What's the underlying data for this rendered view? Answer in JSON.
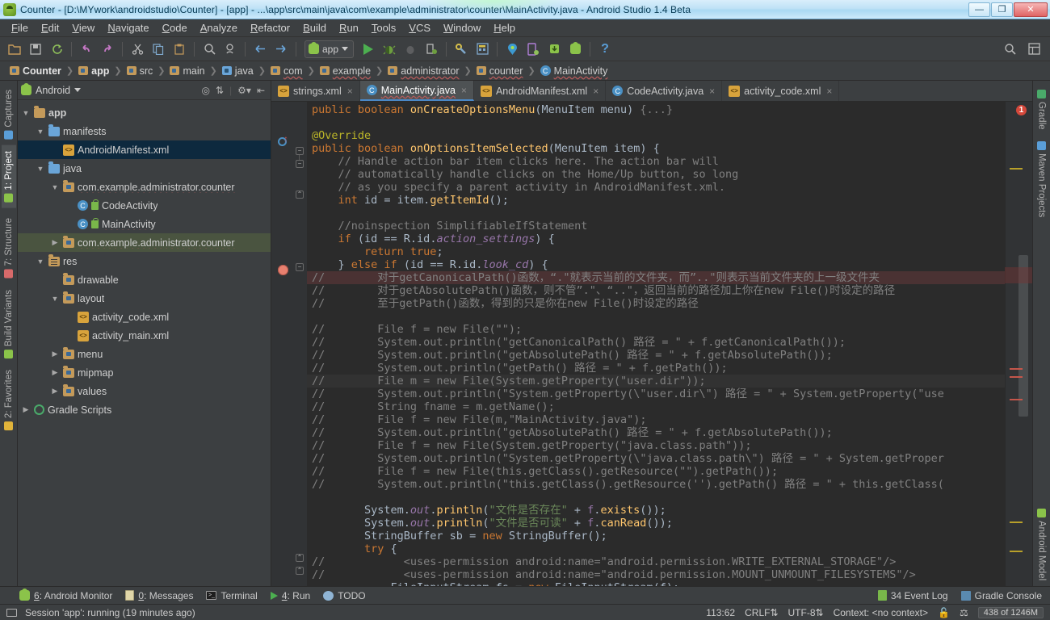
{
  "window": {
    "title": "Counter - [D:\\MYwork\\androidstudio\\Counter] - [app] - ...\\app\\src\\main\\java\\com\\example\\administrator\\counter\\MainActivity.java - Android Studio 1.4 Beta",
    "minimize": "—",
    "maximize": "❐",
    "close": "✕"
  },
  "menu": [
    "File",
    "Edit",
    "View",
    "Navigate",
    "Code",
    "Analyze",
    "Refactor",
    "Build",
    "Run",
    "Tools",
    "VCS",
    "Window",
    "Help"
  ],
  "toolbar": {
    "run_config": "app",
    "icons": [
      "open-folder-icon",
      "save-all-icon",
      "sync-icon",
      "undo-icon",
      "redo-icon",
      "cut-icon",
      "copy-icon",
      "paste-icon",
      "find-icon",
      "find-replace-icon",
      "back-icon",
      "forward-icon"
    ],
    "right_icons": [
      "search-everywhere-icon",
      "layout-inspector-icon"
    ]
  },
  "breadcrumb": [
    {
      "label": "Counter",
      "icon": "module-icon",
      "bold": true
    },
    {
      "label": "app",
      "icon": "module-icon",
      "bold": true
    },
    {
      "label": "src",
      "icon": "folder-icon",
      "bold": false
    },
    {
      "label": "main",
      "icon": "folder-icon",
      "bold": false
    },
    {
      "label": "java",
      "icon": "source-folder-icon",
      "bold": false
    },
    {
      "label": "com",
      "icon": "package-icon",
      "bold": false
    },
    {
      "label": "example",
      "icon": "package-icon",
      "bold": false
    },
    {
      "label": "administrator",
      "icon": "package-icon",
      "bold": false
    },
    {
      "label": "counter",
      "icon": "package-icon",
      "bold": false
    },
    {
      "label": "MainActivity",
      "icon": "class-icon",
      "bold": false
    }
  ],
  "left_rail": [
    {
      "label": "Captures",
      "icon": "captures-icon",
      "active": false
    },
    {
      "label": "1: Project",
      "icon": "project-icon",
      "active": true
    },
    {
      "label": "7: Structure",
      "icon": "structure-icon",
      "active": false
    },
    {
      "label": "Build Variants",
      "icon": "build-variants-icon",
      "active": false
    },
    {
      "label": "2: Favorites",
      "icon": "favorites-icon",
      "active": false
    }
  ],
  "right_rail": [
    {
      "label": "Gradle",
      "icon": "gradle-icon"
    },
    {
      "label": "Maven Projects",
      "icon": "maven-icon"
    },
    {
      "label": "Android Model",
      "icon": "android-model-icon"
    }
  ],
  "project_panel": {
    "view": "Android",
    "tools": [
      "target-icon",
      "collapse-all-icon",
      "settings-icon",
      "hide-icon"
    ],
    "tree": [
      {
        "label": "app",
        "indent": 0,
        "arrow": "down",
        "icon": "module-icon",
        "bold": true,
        "state": ""
      },
      {
        "label": "manifests",
        "indent": 1,
        "arrow": "down",
        "icon": "folder-blue-icon",
        "bold": false,
        "state": ""
      },
      {
        "label": "AndroidManifest.xml",
        "indent": 2,
        "arrow": "none",
        "icon": "xml-icon",
        "bold": false,
        "state": "selected"
      },
      {
        "label": "java",
        "indent": 1,
        "arrow": "down",
        "icon": "folder-blue-icon",
        "bold": false,
        "state": ""
      },
      {
        "label": "com.example.administrator.counter",
        "indent": 2,
        "arrow": "down",
        "icon": "package-icon",
        "bold": false,
        "state": "",
        "wavy": true
      },
      {
        "label": "CodeActivity",
        "indent": 3,
        "arrow": "none",
        "icon": "class-icon",
        "bold": false,
        "state": "",
        "lock": true
      },
      {
        "label": "MainActivity",
        "indent": 3,
        "arrow": "none",
        "icon": "class-icon",
        "bold": false,
        "state": "",
        "lock": true,
        "wavy": true
      },
      {
        "label": "com.example.administrator.counter",
        "indent": 2,
        "arrow": "right",
        "icon": "package-icon",
        "bold": false,
        "state": "hl",
        "wavy": true
      },
      {
        "label": "res",
        "indent": 1,
        "arrow": "down",
        "icon": "res-folder-icon",
        "bold": false,
        "state": ""
      },
      {
        "label": "drawable",
        "indent": 2,
        "arrow": "none",
        "icon": "package-icon",
        "bold": false,
        "state": ""
      },
      {
        "label": "layout",
        "indent": 2,
        "arrow": "down",
        "icon": "package-icon",
        "bold": false,
        "state": ""
      },
      {
        "label": "activity_code.xml",
        "indent": 3,
        "arrow": "none",
        "icon": "xml-icon",
        "bold": false,
        "state": ""
      },
      {
        "label": "activity_main.xml",
        "indent": 3,
        "arrow": "none",
        "icon": "xml-icon",
        "bold": false,
        "state": ""
      },
      {
        "label": "menu",
        "indent": 2,
        "arrow": "right",
        "icon": "package-icon",
        "bold": false,
        "state": ""
      },
      {
        "label": "mipmap",
        "indent": 2,
        "arrow": "right",
        "icon": "package-icon",
        "bold": false,
        "state": ""
      },
      {
        "label": "values",
        "indent": 2,
        "arrow": "right",
        "icon": "package-icon",
        "bold": false,
        "state": ""
      },
      {
        "label": "Gradle Scripts",
        "indent": 0,
        "arrow": "right",
        "icon": "gradle-icon",
        "bold": false,
        "state": ""
      }
    ]
  },
  "editor_tabs": [
    {
      "label": "strings.xml",
      "icon": "xml-icon",
      "active": false
    },
    {
      "label": "MainActivity.java",
      "icon": "class-icon",
      "active": true,
      "wavy": true
    },
    {
      "label": "AndroidManifest.xml",
      "icon": "xml-icon",
      "active": false
    },
    {
      "label": "CodeActivity.java",
      "icon": "class-icon",
      "active": false
    },
    {
      "label": "activity_code.xml",
      "icon": "xml-icon",
      "active": false
    }
  ],
  "code_lines": [
    {
      "t": "partial",
      "text": "public boolean onCreateOptionsMenu(Menu menu) {...}"
    },
    {
      "t": "blank",
      "text": ""
    },
    {
      "t": "ann",
      "text": "@Override"
    },
    {
      "t": "sig",
      "text": "public boolean onOptionsItemSelected(MenuItem item) {"
    },
    {
      "t": "cm",
      "text": "    // Handle action bar item clicks here. The action bar will"
    },
    {
      "t": "cm",
      "text": "    // automatically handle clicks on the Home/Up button, so long"
    },
    {
      "t": "cm",
      "text": "    // as you specify a parent activity in AndroidManifest.xml."
    },
    {
      "t": "idline",
      "text": "    int id = item.getItemId();"
    },
    {
      "t": "blank",
      "text": ""
    },
    {
      "t": "cm",
      "text": "    //noinspection SimplifiableIfStatement"
    },
    {
      "t": "if1",
      "text": "    if (id == R.id.action_settings) {"
    },
    {
      "t": "ret",
      "text": "        return true;"
    },
    {
      "t": "if2",
      "text": "    } else if (id == R.id.look_cd) {"
    },
    {
      "t": "cmcn_bp",
      "text": "//        对于getCanonicalPath()函数，“.\"就表示当前的文件夹，而”..\"则表示当前文件夹的上一级文件夹"
    },
    {
      "t": "cmcn",
      "text": "//        对于getAbsolutePath()函数，则不管”.\"、“..\"，返回当前的路径加上你在new File()时设定的路径"
    },
    {
      "t": "cmcn",
      "text": "//        至于getPath()函数，得到的只是你在new File()时设定的路径"
    },
    {
      "t": "blank",
      "text": ""
    },
    {
      "t": "cm",
      "text": "//        File f = new File(\"\");"
    },
    {
      "t": "cm",
      "text": "//        System.out.println(\"getCanonicalPath() 路径 = \" + f.getCanonicalPath());"
    },
    {
      "t": "cm",
      "text": "//        System.out.println(\"getAbsolutePath() 路径 = \" + f.getAbsolutePath());"
    },
    {
      "t": "cm",
      "text": "//        System.out.println(\"getPath() 路径 = \" + f.getPath());"
    },
    {
      "t": "cm_cur",
      "text": "//        File m = new File(System.getProperty(\"user.dir\"));"
    },
    {
      "t": "cm",
      "text": "//        System.out.println(\"System.getProperty(\\\"user.dir\\\") 路径 = \" + System.getProperty(\"use"
    },
    {
      "t": "cm",
      "text": "//        String fname = m.getName();"
    },
    {
      "t": "cm",
      "text": "//        File f = new File(m,\"MainActivity.java\");"
    },
    {
      "t": "cm",
      "text": "//        System.out.println(\"getAbsolutePath() 路径 = \" + f.getAbsolutePath());"
    },
    {
      "t": "cm",
      "text": "//        File f = new File(System.getProperty(\"java.class.path\"));"
    },
    {
      "t": "cm",
      "text": "//        System.out.println(\"System.getProperty(\\\"java.class.path\\\") 路径 = \" + System.getProper"
    },
    {
      "t": "cm",
      "text": "//        File f = new File(this.getClass().getResource(\"\").getPath());"
    },
    {
      "t": "cm",
      "text": "//        System.out.println(\"this.getClass().getResource('').getPath() 路径 = \" + this.getClass("
    },
    {
      "t": "blank",
      "text": ""
    },
    {
      "t": "exists",
      "text": "        System.out.println(\"文件是否存在\" + f.exists());"
    },
    {
      "t": "canread",
      "text": "        System.out.println(\"文件是否可读\" + f.canRead());"
    },
    {
      "t": "sbuf",
      "text": "        StringBuffer sb = new StringBuffer();"
    },
    {
      "t": "try",
      "text": "        try {"
    },
    {
      "t": "cm",
      "text": "//            <uses-permission android:name=\"android.permission.WRITE_EXTERNAL_STORAGE\"/>"
    },
    {
      "t": "cm",
      "text": "//            <uses-permission android:name=\"android.permission.MOUNT_UNMOUNT_FILESYSTEMS\"/>"
    },
    {
      "t": "fis",
      "text": "            FileInputStream fs = new FileInputStream(f);"
    }
  ],
  "error_stripe": {
    "error_count": "1"
  },
  "bottom_bar": {
    "left": [
      {
        "label": "6: Android Monitor",
        "num": "6",
        "icon": "android-monitor-icon"
      },
      {
        "label": "0: Messages",
        "num": "0",
        "icon": "messages-icon"
      },
      {
        "label": "Terminal",
        "num": "",
        "icon": "terminal-icon"
      },
      {
        "label": "4: Run",
        "num": "4",
        "icon": "run-icon"
      },
      {
        "label": "TODO",
        "num": "",
        "icon": "todo-icon"
      }
    ],
    "right": [
      {
        "label": "34 Event Log",
        "icon": "event-log-icon"
      },
      {
        "label": "Gradle Console",
        "icon": "gradle-console-icon"
      }
    ]
  },
  "status_bar": {
    "session": "Session 'app': running (19 minutes ago)",
    "caret": "113:62",
    "line_ending": "CRLF",
    "encoding": "UTF-8",
    "context": "Context: <no context>",
    "memory": "438 of 1246M"
  }
}
